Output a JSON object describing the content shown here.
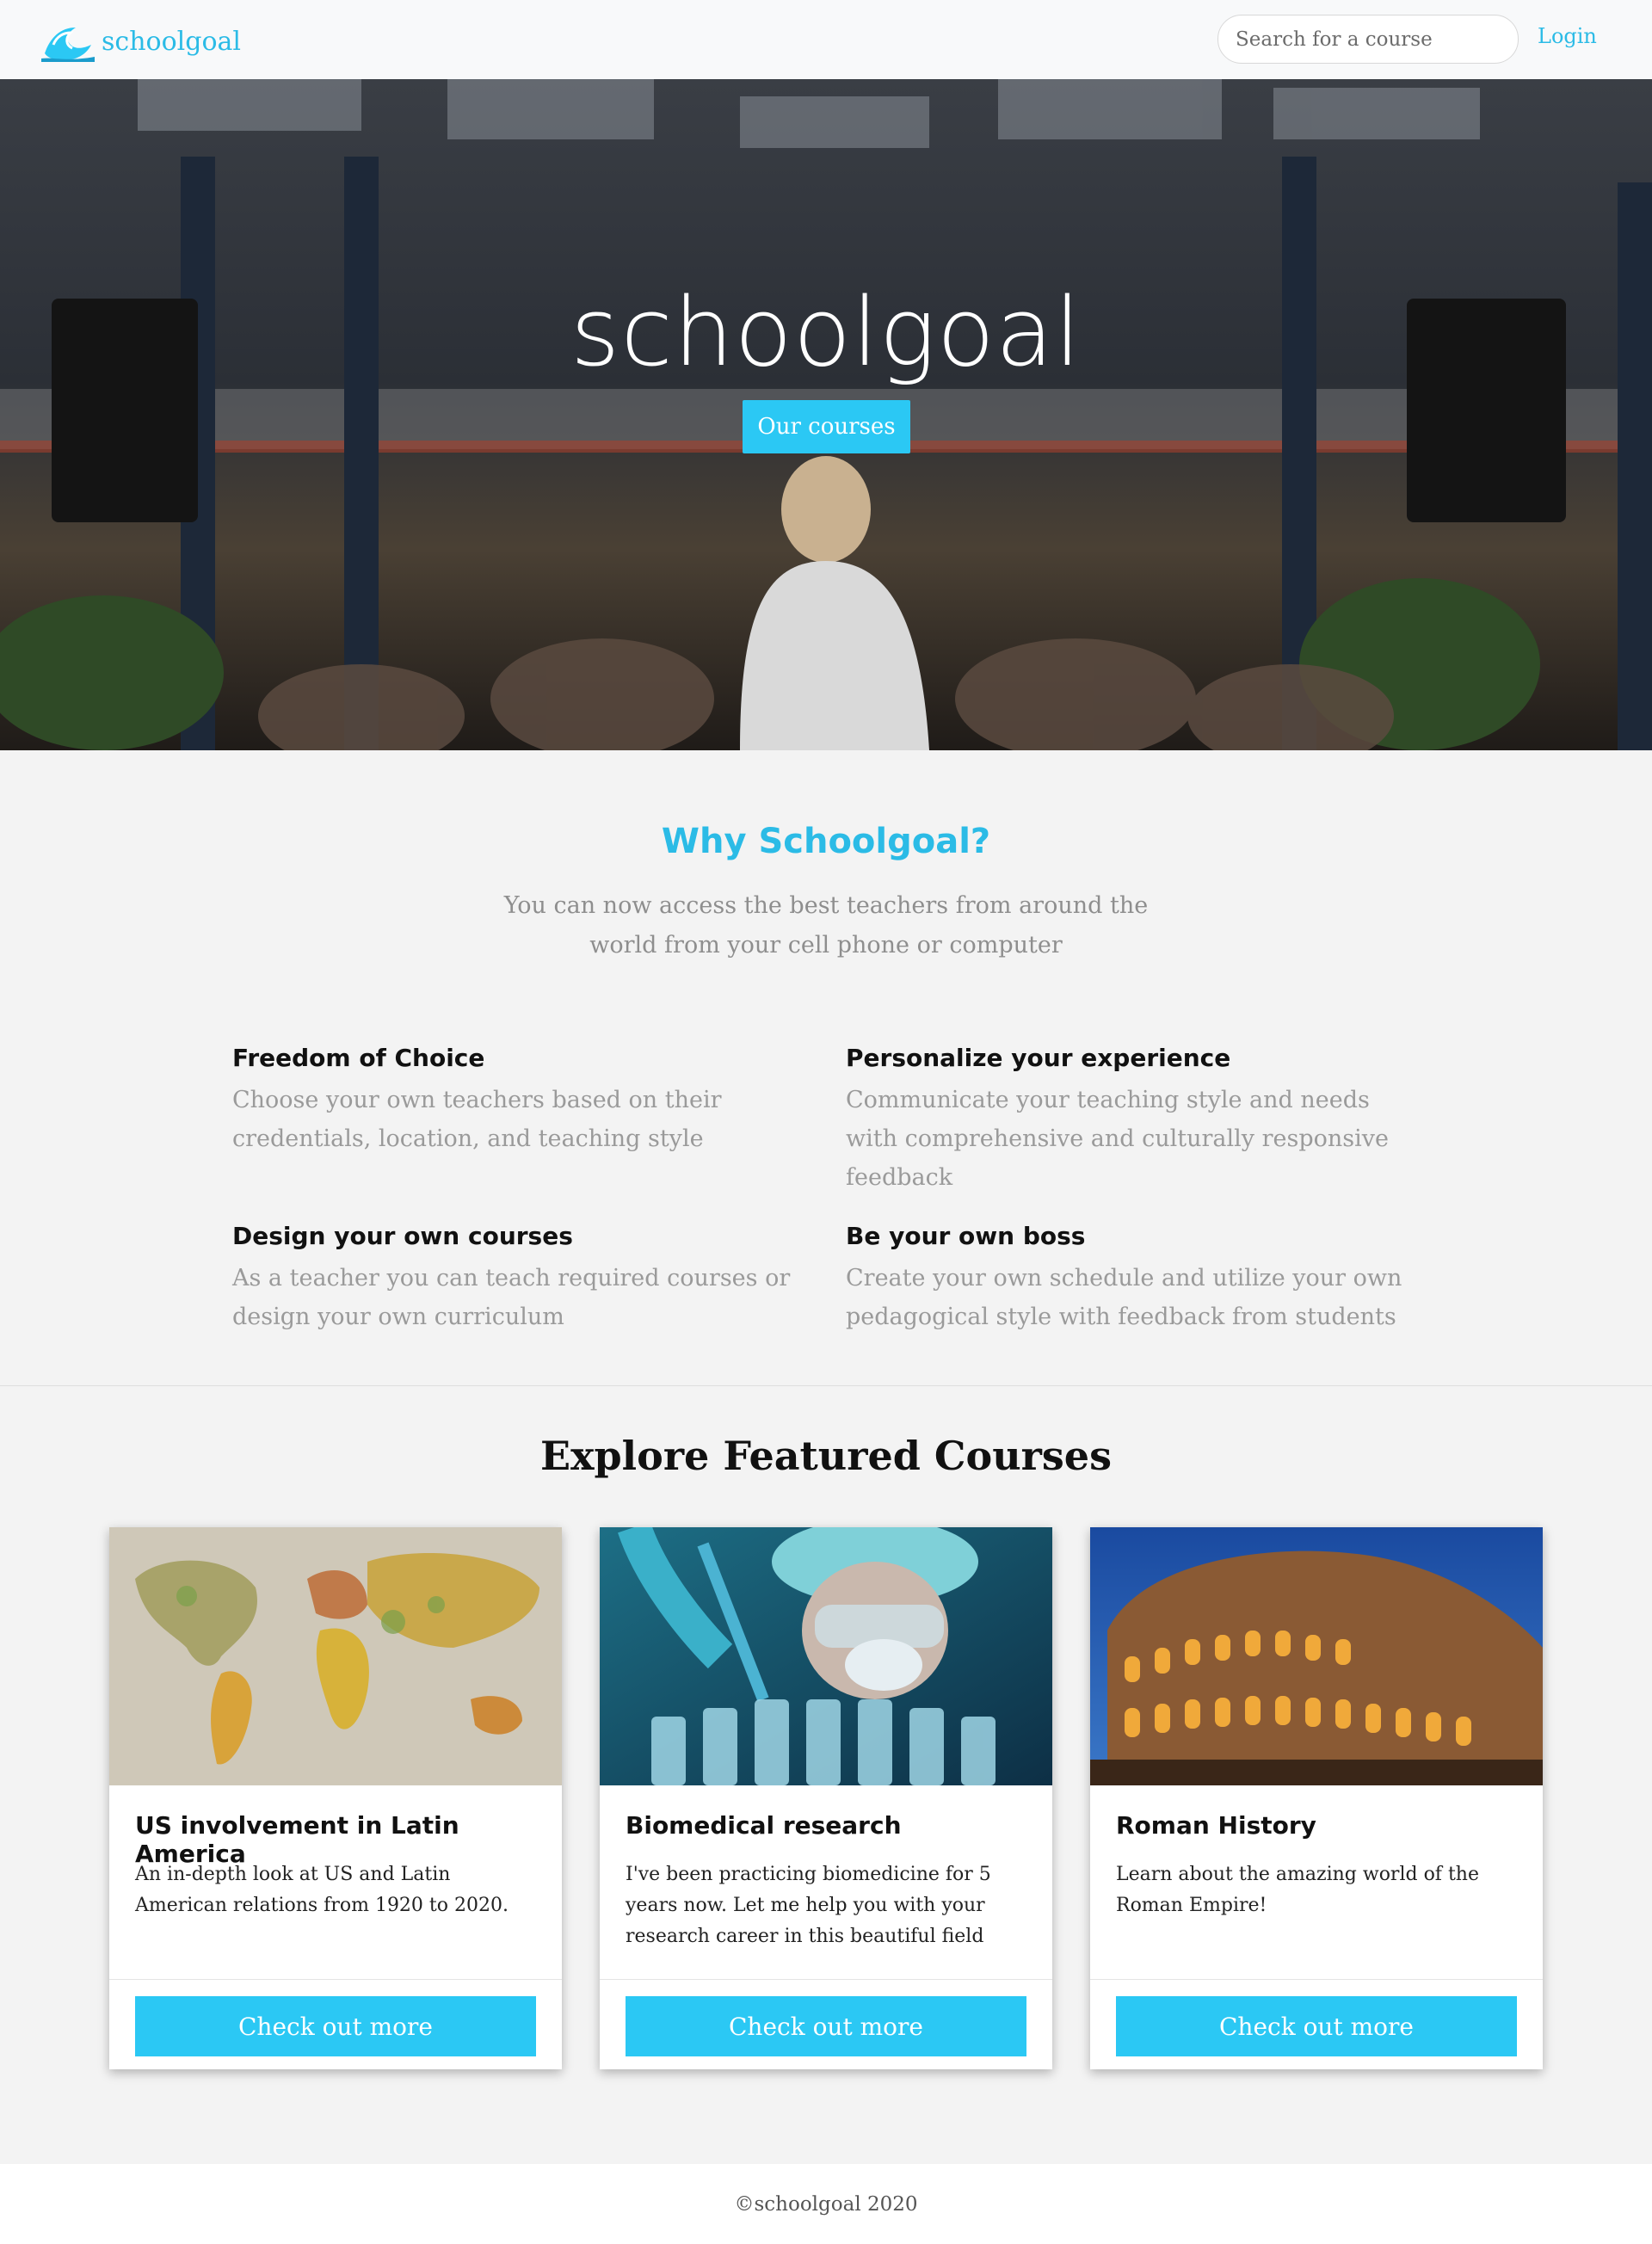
{
  "nav": {
    "brand": "schoolgoal",
    "search_placeholder": "Search for a course",
    "login": "Login"
  },
  "hero": {
    "title": "schoolgoal",
    "button": "Our courses"
  },
  "why": {
    "title": "Why Schoolgoal?",
    "subtitle": "You can now access the best teachers from around the world from your cell phone or computer",
    "features": [
      {
        "title": "Freedom of Choice",
        "text": "Choose your own teachers based on their credentials, location, and teaching style"
      },
      {
        "title": "Personalize your experience",
        "text": "Communicate your teaching style and needs with comprehensive and culturally responsive feedback"
      },
      {
        "title": "Design your own courses",
        "text": "As a teacher you can teach required courses or design your own curriculum"
      },
      {
        "title": "Be your own boss",
        "text": "Create your own schedule and utilize your own pedagogical style with feedback from students"
      }
    ]
  },
  "courses": {
    "title": "Explore Featured Courses",
    "items": [
      {
        "title": "US involvement in Latin America",
        "text": "An in-depth look at US and Latin American relations from 1920 to 2020.",
        "button": "Check out more",
        "image": "world-map"
      },
      {
        "title": "Biomedical research",
        "text": "I've been practicing biomedicine for 5 years now. Let me help you with your research career in this beautiful field",
        "button": "Check out more",
        "image": "lab-scientist"
      },
      {
        "title": "Roman History",
        "text": "Learn about the amazing world of the Roman Empire!",
        "button": "Check out more",
        "image": "colosseum"
      }
    ]
  },
  "footer": {
    "text": "©schoolgoal 2020"
  },
  "colors": {
    "accent": "#2bc8f4",
    "brand_text": "#2bbbe6"
  }
}
